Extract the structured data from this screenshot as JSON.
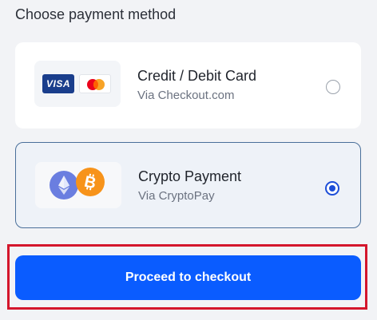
{
  "heading": "Choose payment method",
  "options": [
    {
      "title": "Credit / Debit Card",
      "subtitle": "Via Checkout.com",
      "logos": [
        "visa-logo",
        "mastercard-logo"
      ],
      "visa_text": "VISA",
      "selected": false
    },
    {
      "title": "Crypto Payment",
      "subtitle": "Via CryptoPay",
      "logos": [
        "ethereum-icon",
        "bitcoin-icon"
      ],
      "selected": true
    }
  ],
  "cta_label": "Proceed to checkout",
  "colors": {
    "accent": "#0a5cff",
    "selected_radio": "#1d4ed8",
    "highlight_outline": "#d4162c",
    "visa_blue": "#1a3e8c",
    "eth_purple": "#6a7ee0",
    "btc_orange": "#f7931a"
  }
}
